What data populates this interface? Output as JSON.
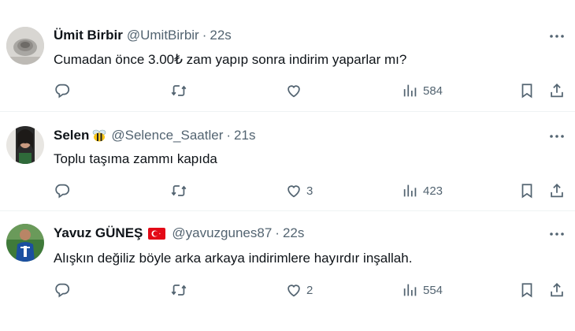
{
  "tweets": [
    {
      "name": "Ümit Birbir",
      "handle": "@UmitBirbir",
      "separator": "·",
      "time": "22s",
      "text": "Cumadan önce 3.00₺ zam yapıp sonra indirim yaparlar mı?",
      "likes": "",
      "views": "584",
      "badge": "",
      "avatar_icon": "profile-photo"
    },
    {
      "name": "Selen",
      "handle": "@Selence_Saatler",
      "separator": "·",
      "time": "21s",
      "text": "Toplu taşıma zammı kapıda",
      "likes": "3",
      "views": "423",
      "badge": "bee-emoji",
      "avatar_icon": "profile-photo"
    },
    {
      "name": "Yavuz GÜNEŞ",
      "handle": "@yavuzgunes87",
      "separator": "·",
      "time": "22s",
      "text": "Alışkın değiliz böyle arka arkaya indirimlere hayırdır inşallah.",
      "likes": "2",
      "views": "554",
      "badge": "turkey-flag",
      "avatar_icon": "profile-photo"
    }
  ],
  "icons": {
    "reply": "reply-icon",
    "retweet": "retweet-icon",
    "like": "heart-icon",
    "views": "views-chart-icon",
    "bookmark": "bookmark-icon",
    "share": "share-icon",
    "more": "more-dots-icon"
  },
  "colors": {
    "text": "#0f1419",
    "secondary": "#536471",
    "divider": "#eff3f4",
    "flag_red": "#e30a17"
  }
}
